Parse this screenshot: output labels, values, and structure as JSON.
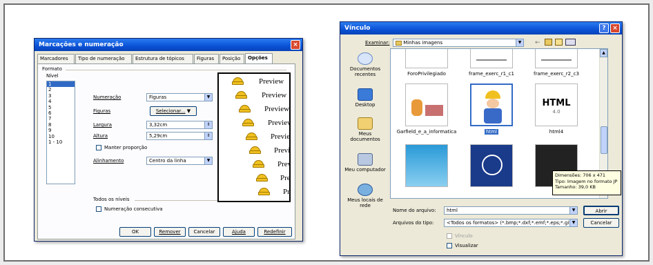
{
  "dialog1": {
    "title": "Marcações e numeração",
    "tabs": [
      "Marcadores",
      "Tipo de numeração",
      "Estrutura de tópicos",
      "Figuras",
      "Posição",
      "Opções"
    ],
    "section_format": "Formato",
    "level_label": "Nível",
    "levels": [
      "1",
      "2",
      "3",
      "4",
      "5",
      "6",
      "7",
      "8",
      "9",
      "10",
      "1 - 10"
    ],
    "numbering_label": "Numeração",
    "numbering_value": "Figuras",
    "figures_label": "Figuras",
    "select_button": "Selecionar...",
    "width_label": "Largura",
    "width_value": "3,32cm",
    "height_label": "Altura",
    "height_value": "5,29cm",
    "keep_ratio_label": "Manter proporção",
    "alignment_label": "Alinhamento",
    "alignment_value": "Centro da linha",
    "preview_text": "Preview",
    "all_levels_label": "Todos os níveis",
    "consecutive_label": "Numeração consecutiva",
    "buttons": {
      "ok": "OK",
      "remove": "Remover",
      "cancel": "Cancelar",
      "help": "Ajuda",
      "reset": "Redefinir"
    }
  },
  "dialog2": {
    "title": "Vínculo",
    "look_in_label": "Examinar:",
    "look_in_value": "Minhas imagens",
    "places": [
      "Documentos recentes",
      "Desktop",
      "Meus documentos",
      "Meu computador",
      "Meus locais de rede"
    ],
    "files_row1": [
      "ForoPrivilegiado",
      "frame_exerc_r1_c1",
      "frame_exerc_r2_c3"
    ],
    "files_row2": [
      "Garfield_e_a_informatica",
      "html",
      "html4"
    ],
    "html4_thumb_text": "HTML",
    "html4_thumb_sub": "4.0",
    "tooltip": {
      "dimensions": "Dimensões: 706 x 471",
      "type": "Tipo: Imagem no formato JP",
      "size": "Tamanho: 39,0 KB"
    },
    "filename_label": "Nome do arquivo:",
    "filename_value": "html",
    "filetype_label": "Arquivos do tipo:",
    "filetype_value": "<Todos os formatos> (*.bmp;*.dxf;*.emf;*.eps;*.gif;*",
    "open_button": "Abrir",
    "cancel_button": "Cancelar",
    "link_checkbox": "Vínculo",
    "preview_checkbox": "Visualizar"
  }
}
